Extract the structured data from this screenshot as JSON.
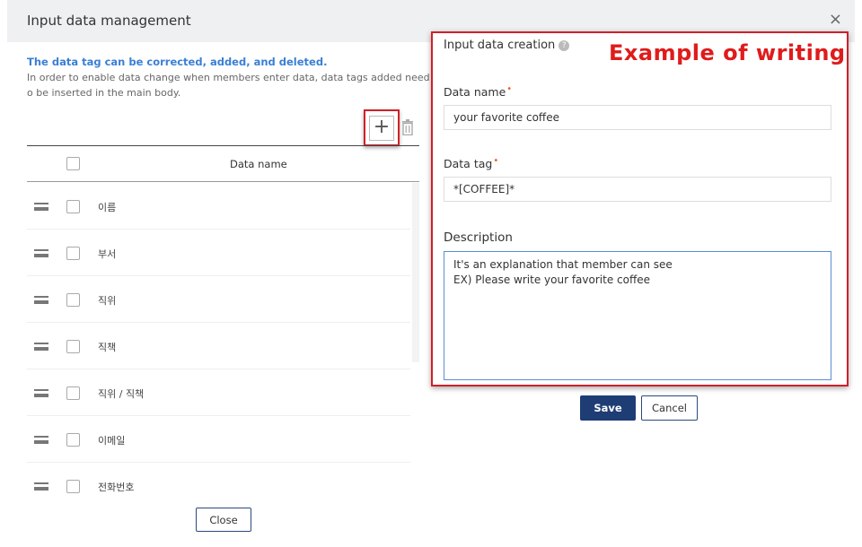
{
  "dialog": {
    "title": "Input data management",
    "close_icon": "×"
  },
  "info": {
    "line1": "The data tag can be corrected, added, and deleted.",
    "line2": "In order to enable data change when members enter data, data tags added need t",
    "line3": "o be inserted in the main body."
  },
  "toolbar": {
    "add_icon": "+",
    "delete_icon": "trash-icon"
  },
  "table": {
    "header": "Data name",
    "rows": [
      {
        "label": "이름"
      },
      {
        "label": "부서"
      },
      {
        "label": "직위"
      },
      {
        "label": "직책"
      },
      {
        "label": "직위 / 직책"
      },
      {
        "label": "이메일"
      },
      {
        "label": "전화번호"
      }
    ]
  },
  "footer": {
    "close_label": "Close"
  },
  "creation": {
    "title": "Input data creation",
    "help_icon": "?",
    "annotation": "Example of writing",
    "data_name_label": "Data name",
    "data_name_value": "your favorite coffee",
    "data_tag_label": "Data tag",
    "data_tag_value": "*[COFFEE]*",
    "description_label": "Description",
    "description_value": "It's an explanation that member can see\nEX) Please write your favorite coffee",
    "required_mark": "•",
    "save_label": "Save",
    "cancel_label": "Cancel"
  },
  "colors": {
    "accent": "#1f3d75",
    "info_blue": "#3a7fd5",
    "highlight_red": "#d0202a",
    "required": "#e8612a"
  }
}
